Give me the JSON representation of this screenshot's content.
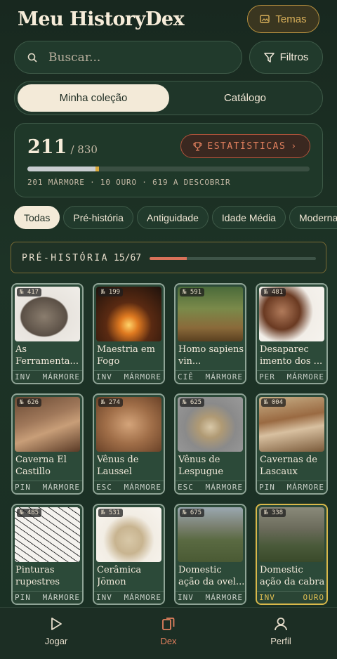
{
  "header": {
    "title": "Meu HistoryDex",
    "theme_label": "Temas"
  },
  "search": {
    "placeholder": "Buscar...",
    "filter_label": "Filtros"
  },
  "tabs": [
    {
      "label": "Minha coleção"
    },
    {
      "label": "Catálogo"
    }
  ],
  "stats": {
    "collected": "211",
    "total": "/ 830",
    "button_label": "ESTATÍSTICAS",
    "summary": "201 MÁRMORE · 10 OURO · 619 A DESCOBRIR",
    "marble_fraction": 0.242,
    "gold_fraction": 0.012
  },
  "chips": [
    "Todas",
    "Pré-história",
    "Antiguidade",
    "Idade Média",
    "Moderna"
  ],
  "era": {
    "name": "PRÉ-HISTÓRIA",
    "count": "15/67",
    "fraction": 0.224
  },
  "cards": [
    {
      "num": "№ 417",
      "title": "As Ferramenta...",
      "tag": "INV",
      "tier": "MÁRMORE",
      "gold": false
    },
    {
      "num": "№ 199",
      "title": "Maestria em Fogo",
      "tag": "INV",
      "tier": "MÁRMORE",
      "gold": false
    },
    {
      "num": "№ 591",
      "title": "Homo sapiens vin...",
      "tag": "CIÊ",
      "tier": "MÁRMORE",
      "gold": false
    },
    {
      "num": "№ 481",
      "title": "Desaparec imento dos ...",
      "tag": "PER",
      "tier": "MÁRMORE",
      "gold": false
    },
    {
      "num": "№ 626",
      "title": "Caverna El Castillo",
      "tag": "PIN",
      "tier": "MÁRMORE",
      "gold": false
    },
    {
      "num": "№ 274",
      "title": "Vênus de Laussel",
      "tag": "ESC",
      "tier": "MÁRMORE",
      "gold": false
    },
    {
      "num": "№ 625",
      "title": "Vênus de Lespugue",
      "tag": "ESC",
      "tier": "MÁRMORE",
      "gold": false
    },
    {
      "num": "№ 004",
      "title": "Cavernas de Lascaux",
      "tag": "PIN",
      "tier": "MÁRMORE",
      "gold": false
    },
    {
      "num": "№ 485",
      "title": "Pinturas rupestres de...",
      "tag": "PIN",
      "tier": "MÁRMORE",
      "gold": false
    },
    {
      "num": "№ 531",
      "title": "Cerâmica Jōmon",
      "tag": "INV",
      "tier": "MÁRMORE",
      "gold": false
    },
    {
      "num": "№ 675",
      "title": "Domestic ação da ovel...",
      "tag": "INV",
      "tier": "MÁRMORE",
      "gold": false
    },
    {
      "num": "№ 338",
      "title": "Domestic ação da cabra",
      "tag": "INV",
      "tier": "OURO",
      "gold": true
    }
  ],
  "nav": [
    {
      "label": "Jogar",
      "icon": "play-icon"
    },
    {
      "label": "Dex",
      "icon": "cards-icon"
    },
    {
      "label": "Perfil",
      "icon": "user-icon"
    }
  ],
  "colors": {
    "accent": "#e2805e",
    "gold": "#d9b05a",
    "background": "#1d3326"
  }
}
